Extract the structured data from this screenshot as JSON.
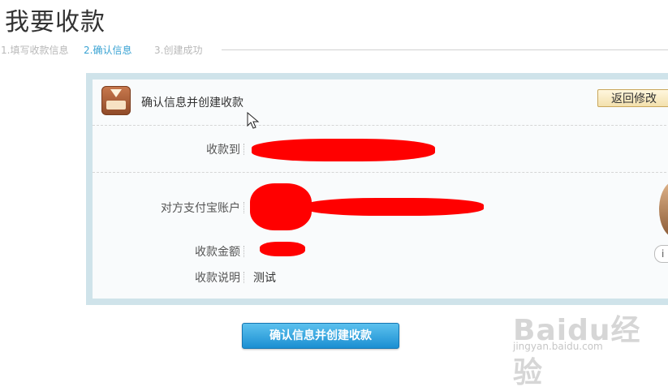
{
  "page": {
    "title": "我要收款"
  },
  "steps": [
    {
      "label": "1.填写收款信息"
    },
    {
      "label": "2.确认信息"
    },
    {
      "label": "3.创建成功"
    }
  ],
  "panel": {
    "header_title": "确认信息并创建收款",
    "back_button": "返回修改",
    "rows": {
      "payee": {
        "label": "收款到",
        "value": ""
      },
      "account": {
        "label": "对方支付宝账户",
        "value": ""
      },
      "amount": {
        "label": "收款金额",
        "value": ""
      },
      "note": {
        "label": "收款说明",
        "value": "测试"
      }
    },
    "side_button": "i"
  },
  "confirm_button": "确认信息并创建收款",
  "watermark": {
    "brand": "Baidu经验",
    "url": "jingyan.baidu.com"
  },
  "colors": {
    "active_step": "#3aa3d3",
    "panel_border": "#cfe3ea",
    "primary": "#1b8fd2",
    "redaction": "#ff0000"
  }
}
